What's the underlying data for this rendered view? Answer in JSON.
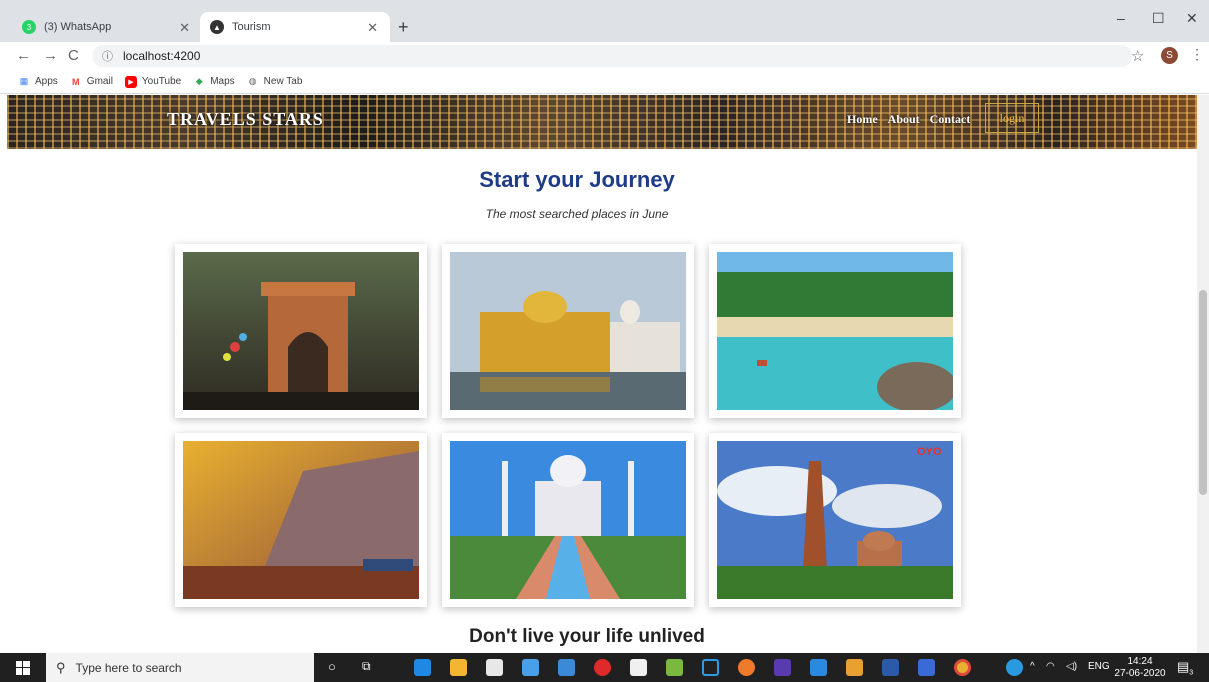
{
  "browser": {
    "tabs": [
      {
        "label": "(3) WhatsApp",
        "badge": "3"
      },
      {
        "label": "Tourism"
      }
    ],
    "new_tab": "+",
    "window_controls": {
      "minimize": "–",
      "maximize": "☐",
      "close": "✕"
    },
    "url": "localhost:4200",
    "bookmarks": [
      "Apps",
      "Gmail",
      "YouTube",
      "Maps",
      "New Tab"
    ],
    "avatar_letter": "S"
  },
  "site": {
    "brand": "TRAVELS STARS",
    "menu": [
      "Home",
      "About",
      "Contact"
    ],
    "login_label": "login",
    "section_title": "Start your Journey",
    "section_subtitle": "The most searched places in June",
    "gallery": [
      {
        "name": "india-gate-image"
      },
      {
        "name": "golden-temple-image"
      },
      {
        "name": "goa-beach-image"
      },
      {
        "name": "varanasi-ghats-image"
      },
      {
        "name": "taj-mahal-image"
      },
      {
        "name": "qutub-minar-image",
        "watermark": "OYO"
      }
    ],
    "bottom_title": "Don't live your life unlived"
  },
  "taskbar": {
    "search_placeholder": "Type here to search",
    "language": "ENG",
    "time": "14:24",
    "date": "27-06-2020",
    "notification_count": "3"
  },
  "colors": {
    "title_blue": "#1f3c88",
    "login_gold": "#c9a640",
    "taskbar": "#202020"
  }
}
